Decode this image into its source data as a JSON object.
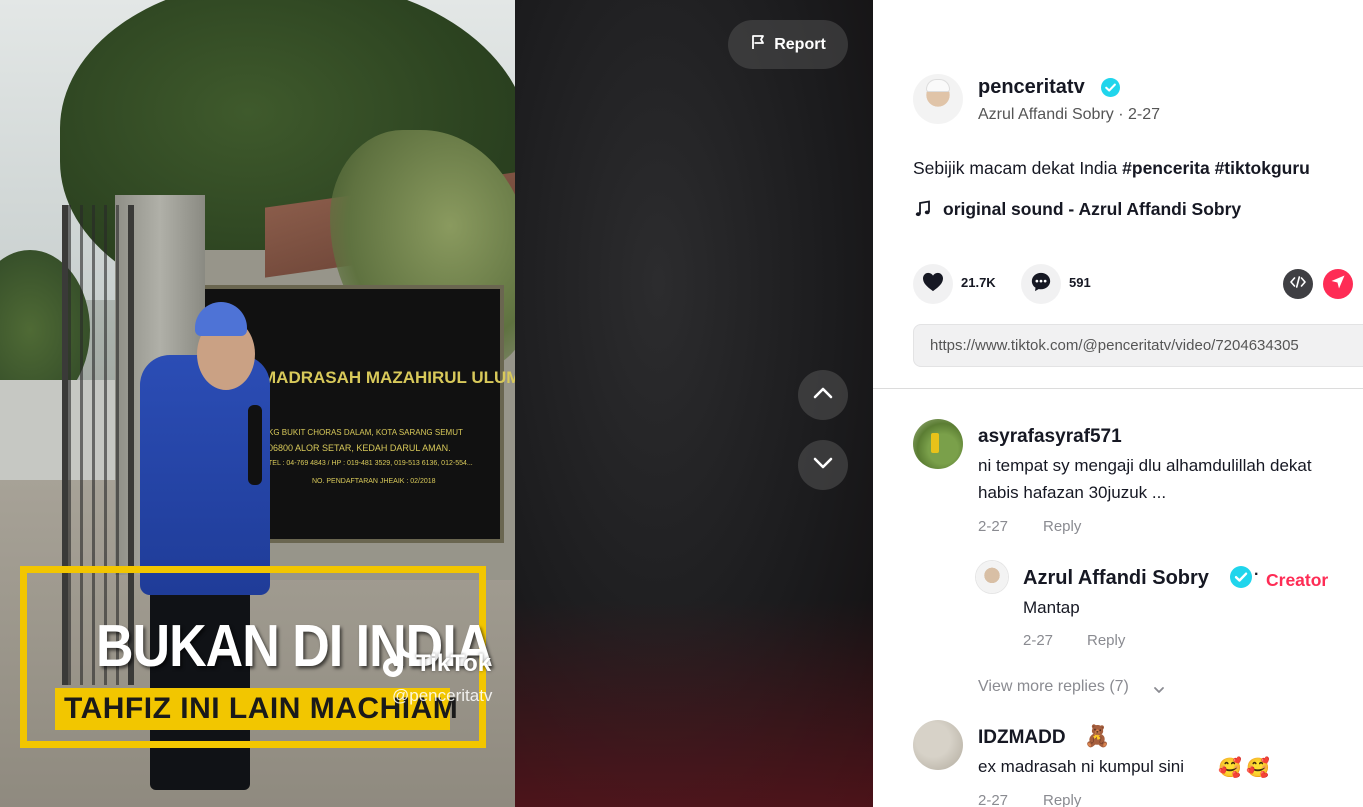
{
  "video": {
    "overlay_title": "BUKAN DI INDIA",
    "overlay_subtitle": "TAHFIZ INI LAIN MACHIAM",
    "watermark_brand": "TikTok",
    "watermark_user": "@penceritatv",
    "sign_lines": [
      "MADRASAH MAZAHIRUL ULUM",
      "KG BUKIT CHORAS DALAM, KOTA SARANG SEMUT",
      "06800 ALOR SETAR, KEDAH DARUL AMAN.",
      "TEL : 04-769 4843 / HP : 019-481 3529, 019-513 6136, 012-554...",
      "NO. PENDAFTARAN JHEAIK : 02/2018"
    ]
  },
  "controls": {
    "report_label": "Report",
    "nav_up_icon": "chevron-up-icon",
    "nav_down_icon": "chevron-down-icon"
  },
  "post": {
    "handle": "penceritatv",
    "verified": true,
    "sub": "Azrul Affandi Sobry · 2-27",
    "caption_text": "Sebijik macam dekat India ",
    "hashtags": [
      "#pencerita",
      "#tiktokguru"
    ],
    "sound": "original sound - Azrul Affandi Sobry",
    "likes": "21.7K",
    "comments": "591",
    "link": "https://www.tiktok.com/@penceritatv/video/7204634305"
  },
  "comments": [
    {
      "username": "asyrafasyraf571",
      "line1": "ni tempat sy mengaji dlu alhamdulillah dekat",
      "line2": "habis hafazan 30juzuk ...",
      "date": "2-27",
      "reply_label": "Reply",
      "replies": [
        {
          "username": "Azrul Affandi Sobry",
          "verified": true,
          "dot": "·",
          "badge": "Creator",
          "text": "Mantap",
          "date": "2-27",
          "reply_label": "Reply"
        }
      ],
      "more_replies": "View more replies (7)"
    },
    {
      "username": "IDZMADD",
      "emoji": "🧸",
      "text": "ex madrasah ni kumpul sini",
      "text_emojis": [
        "🥰",
        "🥰"
      ],
      "date": "2-27",
      "reply_label": "Reply"
    }
  ],
  "colors": {
    "accent": "#fe2c55",
    "verified": "#20d5ec",
    "overlay_yellow": "#f2c600"
  }
}
